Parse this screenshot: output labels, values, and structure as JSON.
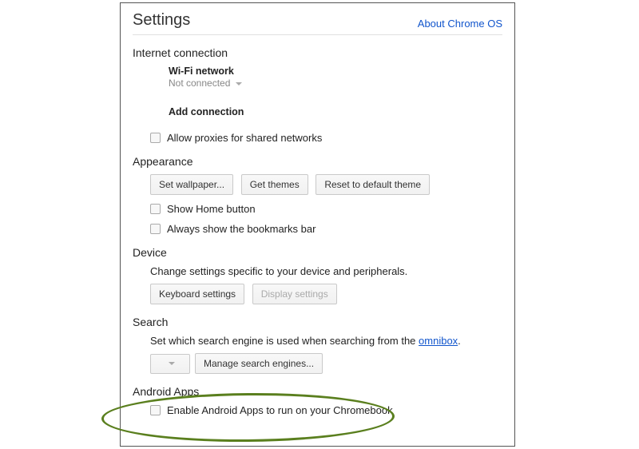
{
  "header": {
    "title": "Settings",
    "about_link": "About Chrome OS"
  },
  "internet": {
    "title": "Internet connection",
    "wifi_label": "Wi-Fi network",
    "wifi_status": "Not connected",
    "add_connection": "Add connection",
    "allow_proxies_label": "Allow proxies for shared networks"
  },
  "appearance": {
    "title": "Appearance",
    "set_wallpaper_btn": "Set wallpaper...",
    "get_themes_btn": "Get themes",
    "reset_theme_btn": "Reset to default theme",
    "show_home_label": "Show Home button",
    "show_bookmarks_label": "Always show the bookmarks bar"
  },
  "device": {
    "title": "Device",
    "desc": "Change settings specific to your device and peripherals.",
    "keyboard_btn": "Keyboard settings",
    "display_btn": "Display settings"
  },
  "search": {
    "title": "Search",
    "desc_pre": "Set which search engine is used when searching from the ",
    "omnibox_link": "omnibox",
    "desc_post": ".",
    "manage_btn": "Manage search engines..."
  },
  "android": {
    "title": "Android Apps",
    "enable_label": "Enable Android Apps to run on your Chromebook"
  }
}
